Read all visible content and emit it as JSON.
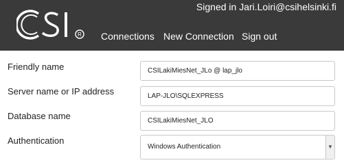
{
  "header": {
    "signed_in": "Signed in Jari.Loiri@csihelsinki.fi",
    "logo_icon": "csi-logo",
    "nav": {
      "connections": "Connections",
      "new_connection": "New Connection",
      "sign_out": "Sign out"
    }
  },
  "form": {
    "friendly_name": {
      "label": "Friendly name",
      "value": "CSILakiMiesNet_JLo @ lap_jlo"
    },
    "server_name": {
      "label": "Server name or IP address",
      "value": "LAP-JLO\\SQLEXPRESS"
    },
    "database_name": {
      "label": "Database name",
      "value": "CSILakiMiesNet_JLO"
    },
    "authentication": {
      "label": "Authentication",
      "value": "Windows Authentication"
    }
  },
  "colors": {
    "header_bg": "#3a3a3a",
    "header_text": "#ffffff",
    "field_border": "#c8c8c8"
  }
}
